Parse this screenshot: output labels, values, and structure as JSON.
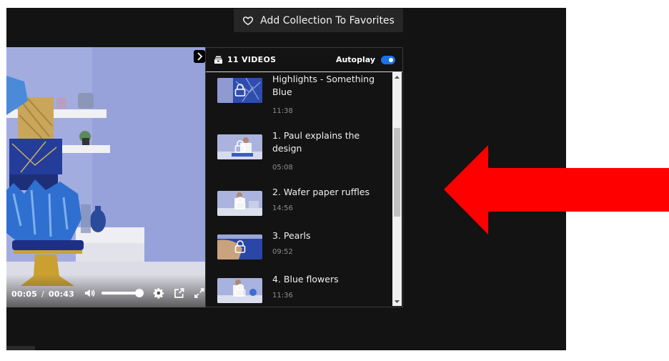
{
  "favorites_button": {
    "label": "Add Collection To Favorites",
    "icon": "heart-outline-icon"
  },
  "player": {
    "current_time": "00:05",
    "separator": "/",
    "total_time": "00:43",
    "volume_fraction": 1.0,
    "icons": [
      "volume-icon",
      "settings-gear-icon",
      "popout-icon",
      "fullscreen-icon"
    ]
  },
  "playlist": {
    "count_label": "11 VIDEOS",
    "autoplay_label": "Autoplay",
    "autoplay_on": true,
    "accent_color": "#1a73e8",
    "items": [
      {
        "title": "Highlights - Something Blue",
        "duration": "11:38",
        "locked": true
      },
      {
        "title": "1. Paul explains the design",
        "duration": "05:08",
        "locked": true
      },
      {
        "title": "2. Wafer paper ruffles",
        "duration": "14:56",
        "locked": true
      },
      {
        "title": "3. Pearls",
        "duration": "09:52",
        "locked": true
      },
      {
        "title": "4. Blue flowers",
        "duration": "11:36",
        "locked": true
      }
    ]
  },
  "annotation": {
    "type": "arrow",
    "direction": "left",
    "color": "#ff0000"
  }
}
